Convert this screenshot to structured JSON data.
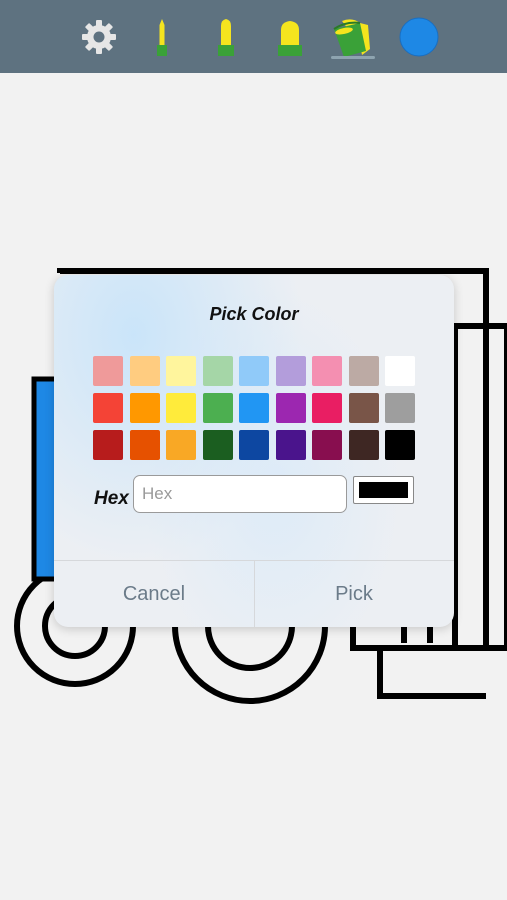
{
  "toolbar": {
    "background": "#5e7280",
    "tools": [
      {
        "name": "settings-gear-icon",
        "selected": false
      },
      {
        "name": "thin-marker-icon",
        "selected": false
      },
      {
        "name": "medium-marker-icon",
        "selected": false
      },
      {
        "name": "thick-marker-icon",
        "selected": false
      },
      {
        "name": "paint-bucket-icon",
        "selected": true
      },
      {
        "name": "current-color-circle-icon",
        "color": "#1e88e5",
        "selected": false
      }
    ]
  },
  "dialog": {
    "title": "Pick Color",
    "palette": [
      [
        "#ef9a9a",
        "#ffcc80",
        "#fff59d",
        "#a5d6a7",
        "#90caf9",
        "#b39ddb",
        "#f48fb1",
        "#bcaaa4",
        "#ffffff"
      ],
      [
        "#f44336",
        "#ff9800",
        "#ffeb3b",
        "#4caf50",
        "#2196f3",
        "#9c27b0",
        "#e91e63",
        "#795548",
        "#9e9e9e"
      ],
      [
        "#b71c1c",
        "#e65100",
        "#f9a825",
        "#1b5e20",
        "#0d47a1",
        "#4a148c",
        "#880e4f",
        "#3e2723",
        "#000000"
      ]
    ],
    "hex_label": "Hex",
    "hex_value": "",
    "hex_placeholder": "Hex",
    "preview_color": "#000000",
    "cancel_label": "Cancel",
    "pick_label": "Pick"
  },
  "colors": {
    "accent_blue": "#1e88e5",
    "marker_yellow": "#f5e41e",
    "marker_green": "#3aa138",
    "button_text": "#6b7b89"
  }
}
